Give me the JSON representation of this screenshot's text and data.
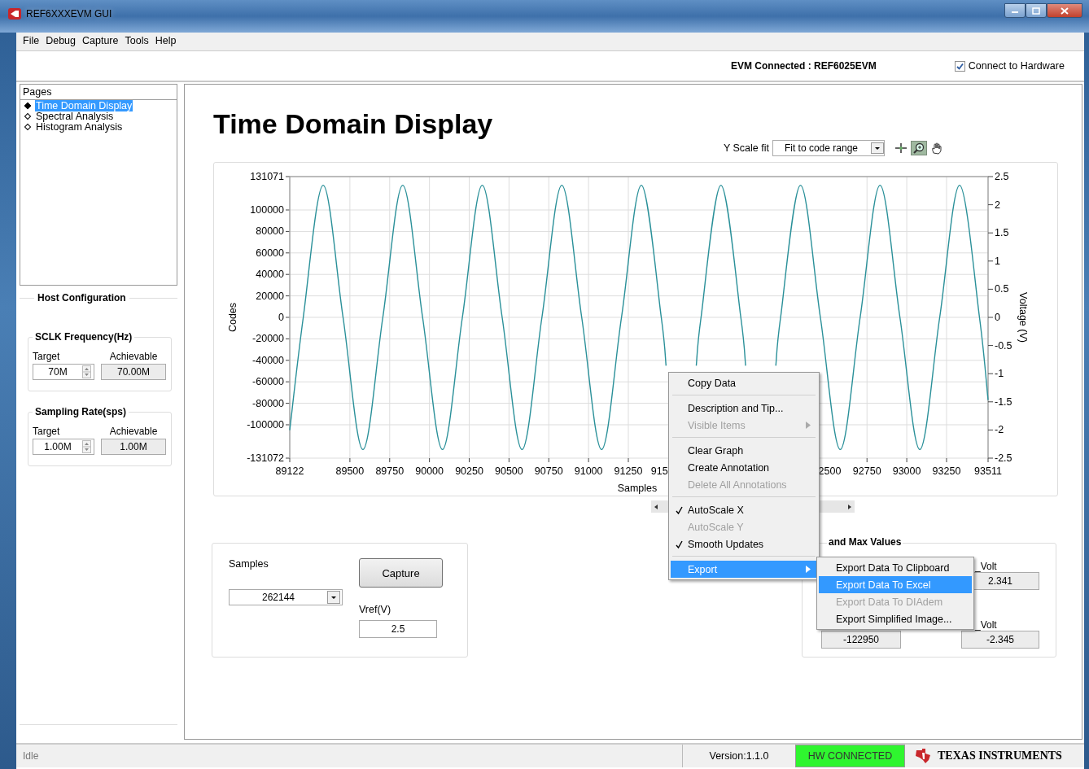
{
  "window": {
    "title": "REF6XXXEVM GUI"
  },
  "menu_bar": [
    "File",
    "Debug",
    "Capture",
    "Tools",
    "Help"
  ],
  "connection": {
    "label": "EVM Connected : REF6025EVM",
    "connect_to_hardware": {
      "label": "Connect to Hardware",
      "checked": true
    }
  },
  "pages": {
    "title": "Pages",
    "items": [
      {
        "label": "Time Domain Display",
        "selected": true
      },
      {
        "label": "Spectral Analysis",
        "selected": false
      },
      {
        "label": "Histogram Analysis",
        "selected": false
      }
    ]
  },
  "host_configuration": {
    "title": "Host Configuration",
    "groups": [
      {
        "title": "SCLK Frequency(Hz)",
        "target_label": "Target",
        "target": "70M",
        "achievable_label": "Achievable",
        "achievable": "70.00M"
      },
      {
        "title": "Sampling Rate(sps)",
        "target_label": "Target",
        "target": "1.00M",
        "achievable_label": "Achievable",
        "achievable": "1.00M"
      }
    ]
  },
  "page_title": "Time Domain Display",
  "y_scale": {
    "label": "Y Scale fit",
    "value": "Fit to code range"
  },
  "graph_tools": [
    {
      "kind": "cursor",
      "selected": false
    },
    {
      "kind": "zoom",
      "selected": true
    },
    {
      "kind": "pan",
      "selected": false
    }
  ],
  "graph": {
    "chart_data": {
      "type": "line",
      "xlabel": "Samples",
      "ylabel": "Codes",
      "grid": true,
      "x": [
        89122,
        89207,
        89332,
        89457,
        89582,
        89707,
        89832,
        89957,
        90082,
        90207,
        90332,
        90457,
        90582,
        90707,
        90832,
        90957,
        91082,
        91207,
        91332,
        91457,
        91487,
        91582,
        91677,
        91707,
        91832,
        91957,
        91987,
        92082,
        92177,
        92207,
        92332,
        92457,
        92582,
        92707,
        92832,
        92957,
        93082,
        93207,
        93332,
        93457,
        93511
      ],
      "series": [
        {
          "color": "#2a9099",
          "values": [
            -105000,
            0,
            123000,
            0,
            -123000,
            0,
            123000,
            0,
            -123000,
            0,
            123000,
            0,
            -123000,
            0,
            123000,
            0,
            -123000,
            0,
            123000,
            0,
            -45000,
            null,
            -45000,
            0,
            123000,
            0,
            -45000,
            null,
            -45000,
            0,
            123000,
            0,
            -123000,
            0,
            123000,
            0,
            -123000,
            0,
            123000,
            0,
            -77000
          ]
        }
      ],
      "xlim": [
        89122,
        93511
      ],
      "ylim": [
        -131072,
        131071
      ],
      "xticks": [
        89122,
        89500,
        89750,
        90000,
        90250,
        90500,
        90750,
        91000,
        91250,
        92750,
        93000,
        93250,
        93511
      ],
      "yticks": [
        131071,
        100000,
        80000,
        60000,
        40000,
        20000,
        0,
        -20000,
        -40000,
        -60000,
        -80000,
        -100000,
        -131072
      ]
    },
    "covered_x_labels": [
      "915",
      "2500"
    ],
    "right_axis": {
      "label": "Voltage (V)",
      "ticks": [
        "2.5",
        "2",
        "1.5",
        "1",
        "0.5",
        "0",
        "-0.5",
        "-1",
        "-1.5",
        "-2",
        "-2.5"
      ]
    }
  },
  "capture": {
    "samples_label": "Samples",
    "samples": "262144",
    "button": "Capture",
    "vref_label": "Vref(V)",
    "vref": "2.5"
  },
  "min_max": {
    "title": "and Max Values",
    "codes_min": "-122950",
    "max_volt_label": "_Volt",
    "max_volt": "2.341",
    "min_volt_label": "_Volt",
    "min_volt": "-2.345"
  },
  "context_menu": {
    "items": [
      {
        "kind": "item",
        "label": "Copy Data",
        "disabled": false,
        "selected": false,
        "submenu": false
      },
      {
        "kind": "separator"
      },
      {
        "kind": "item",
        "label": "Description and Tip...",
        "disabled": false,
        "selected": false,
        "submenu": false
      },
      {
        "kind": "item",
        "label": "Visible Items",
        "disabled": true,
        "selected": false,
        "submenu": true
      },
      {
        "kind": "separator"
      },
      {
        "kind": "item",
        "label": "Clear Graph",
        "disabled": false,
        "selected": false,
        "submenu": false
      },
      {
        "kind": "item",
        "label": "Create Annotation",
        "disabled": false,
        "selected": false,
        "submenu": false
      },
      {
        "kind": "item",
        "label": "Delete All Annotations",
        "disabled": true,
        "selected": false,
        "submenu": false
      },
      {
        "kind": "separator"
      },
      {
        "kind": "check",
        "label": "AutoScale X",
        "checked": true,
        "disabled": false,
        "selected": false,
        "submenu": false
      },
      {
        "kind": "check",
        "label": "AutoScale Y",
        "checked": false,
        "disabled": true,
        "selected": false,
        "submenu": false
      },
      {
        "kind": "check",
        "label": "Smooth Updates",
        "checked": true,
        "disabled": false,
        "selected": false,
        "submenu": false
      },
      {
        "kind": "separator"
      },
      {
        "kind": "item",
        "label": "Export",
        "disabled": false,
        "selected": true,
        "submenu": true
      }
    ]
  },
  "export_submenu": {
    "items": [
      {
        "kind": "item",
        "label": "Export Data To Clipboard",
        "disabled": false,
        "selected": false,
        "submenu": false
      },
      {
        "kind": "item",
        "label": "Export Data To Excel",
        "disabled": false,
        "selected": true,
        "submenu": false
      },
      {
        "kind": "item",
        "label": "Export Data To DIAdem",
        "disabled": true,
        "selected": false,
        "submenu": false
      },
      {
        "kind": "item",
        "label": "Export Simplified Image...",
        "disabled": false,
        "selected": false,
        "submenu": false
      }
    ]
  },
  "status_bar": {
    "status": "Idle",
    "version": "Version:1.1.0",
    "hw_status": "HW CONNECTED",
    "brand": "TEXAS INSTRUMENTS"
  }
}
